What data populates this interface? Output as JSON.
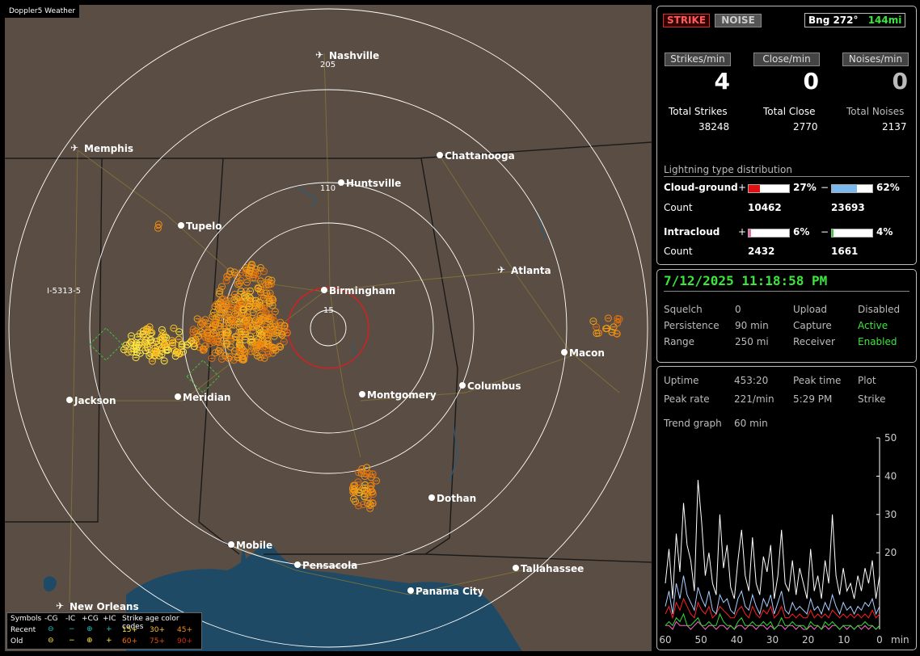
{
  "app": {
    "title": "Doppler5 Weather"
  },
  "map": {
    "cities": [
      {
        "name": "Nashville",
        "airport": true
      },
      {
        "name": "Memphis",
        "airport": true
      },
      {
        "name": "Chattanooga",
        "airport": false
      },
      {
        "name": "Huntsville",
        "airport": false
      },
      {
        "name": "Tupelo",
        "airport": false
      },
      {
        "name": "Birmingham",
        "airport": false
      },
      {
        "name": "Atlanta",
        "airport": true
      },
      {
        "name": "Macon",
        "airport": false
      },
      {
        "name": "Jackson",
        "airport": false
      },
      {
        "name": "Meridian",
        "airport": false
      },
      {
        "name": "Montgomery",
        "airport": false
      },
      {
        "name": "Columbus",
        "airport": false
      },
      {
        "name": "Dothan",
        "airport": false
      },
      {
        "name": "Mobile",
        "airport": false
      },
      {
        "name": "Pensacola",
        "airport": false
      },
      {
        "name": "Tallahassee",
        "airport": false
      },
      {
        "name": "Panama City",
        "airport": false
      },
      {
        "name": "New Orleans",
        "airport": true
      }
    ],
    "ring_labels": [
      "205",
      "110",
      "15"
    ],
    "road_label": "I-5313-5",
    "colors": {
      "land": "#5a4d44",
      "water": "#1e4a66",
      "ring": "#ffffff",
      "close_ring": "#d42020",
      "recent": "#ffe840",
      "older": "#f08a10"
    }
  },
  "legend": {
    "symbols_label": "Symbols",
    "cols": [
      "-CG",
      "-IC",
      "+CG",
      "+IC"
    ],
    "age_label": "Strike age color codes",
    "recent_label": "Recent",
    "old_label": "Old",
    "recent_ages": [
      "15+",
      "30+",
      "45+"
    ],
    "old_ages": [
      "60+",
      "75+",
      "90+"
    ]
  },
  "status": {
    "strike_btn": "STRIKE",
    "noise_btn": "NOISE",
    "bearing": "Bng 272°",
    "distance": "144mi",
    "rate_headers": [
      "Strikes/min",
      "Close/min",
      "Noises/min"
    ],
    "rate_values": [
      "4",
      "0",
      "0"
    ],
    "total_labels": [
      "Total Strikes",
      "Total Close",
      "Total Noises"
    ],
    "total_values": [
      "38248",
      "2770",
      "2137"
    ],
    "dist_title": "Lightning type distribution",
    "cg_label": "Cloud-ground",
    "cg_pos_pct": "27%",
    "cg_neg_pct": "62%",
    "cg_pos_frac": 0.27,
    "cg_neg_frac": 0.62,
    "count_label": "Count",
    "cg_pos_count": "10462",
    "cg_neg_count": "23693",
    "ic_label": "Intracloud",
    "ic_pos_pct": "6%",
    "ic_neg_pct": "4%",
    "ic_pos_frac": 0.06,
    "ic_neg_frac": 0.04,
    "ic_pos_count": "2432",
    "ic_neg_count": "1661",
    "plus": "+",
    "minus": "−"
  },
  "settings": {
    "datetime": "7/12/2025 11:18:58 PM",
    "rows": [
      {
        "k1": "Squelch",
        "v1": "0",
        "k2": "Upload",
        "v2": "Disabled"
      },
      {
        "k1": "Persistence",
        "v1": "90 min",
        "k2": "Capture",
        "v2": "Active"
      },
      {
        "k1": "Range",
        "v1": "250 mi",
        "k2": "Receiver",
        "v2": "Enabled"
      }
    ]
  },
  "stats": {
    "uptime_label": "Uptime",
    "uptime": "453:20",
    "peak_time_label": "Peak time",
    "plot_label": "Plot",
    "peak_rate_label": "Peak rate",
    "peak_rate": "221/min",
    "peak_time": "5:29 PM",
    "plot": "Strike",
    "trend_label": "Trend graph",
    "trend": "60 min"
  },
  "chart_data": {
    "type": "line",
    "title": "",
    "xlabel": "min",
    "ylabel": "",
    "x_ticks": [
      "60",
      "50",
      "40",
      "30",
      "20",
      "10",
      "0"
    ],
    "y_ticks": [
      "50",
      "40",
      "30",
      "20"
    ],
    "ylim": [
      0,
      50
    ],
    "xlim": [
      60,
      0
    ],
    "series": [
      {
        "color": "#ffffff",
        "values": [
          12,
          21,
          8,
          25,
          15,
          33,
          22,
          18,
          10,
          39,
          28,
          14,
          20,
          12,
          9,
          30,
          16,
          22,
          11,
          8,
          18,
          26,
          14,
          10,
          24,
          12,
          9,
          19,
          15,
          22,
          8,
          14,
          26,
          12,
          10,
          18,
          9,
          16,
          12,
          8,
          21,
          10,
          14,
          8,
          18,
          12,
          30,
          14,
          9,
          16,
          10,
          12,
          8,
          14,
          10,
          16,
          12,
          18,
          8,
          14
        ]
      },
      {
        "color": "#aaccff",
        "values": [
          6,
          10,
          4,
          12,
          8,
          14,
          9,
          7,
          5,
          11,
          8,
          6,
          10,
          5,
          4,
          9,
          7,
          8,
          5,
          4,
          8,
          10,
          6,
          5,
          9,
          6,
          4,
          8,
          6,
          9,
          4,
          7,
          10,
          5,
          4,
          7,
          5,
          6,
          5,
          4,
          8,
          5,
          6,
          4,
          7,
          5,
          9,
          6,
          4,
          7,
          5,
          6,
          4,
          6,
          5,
          7,
          6,
          8,
          4,
          6
        ]
      },
      {
        "color": "#ff2020",
        "values": [
          4,
          6,
          3,
          7,
          5,
          8,
          6,
          4,
          3,
          7,
          5,
          4,
          6,
          3,
          4,
          6,
          5,
          4,
          3,
          3,
          5,
          6,
          4,
          3,
          6,
          4,
          3,
          5,
          4,
          6,
          3,
          4,
          6,
          3,
          3,
          4,
          3,
          4,
          3,
          3,
          5,
          3,
          4,
          3,
          4,
          3,
          5,
          4,
          3,
          4,
          3,
          4,
          3,
          4,
          3,
          4,
          3,
          5,
          3,
          4
        ]
      },
      {
        "color": "#30e030",
        "values": [
          1,
          2,
          1,
          3,
          2,
          4,
          1,
          1,
          2,
          3,
          1,
          1,
          2,
          1,
          1,
          4,
          2,
          1,
          1,
          0,
          2,
          3,
          1,
          1,
          2,
          1,
          1,
          2,
          1,
          2,
          0,
          1,
          3,
          1,
          1,
          2,
          1,
          1,
          1,
          0,
          2,
          1,
          1,
          0,
          2,
          1,
          2,
          1,
          0,
          1,
          1,
          1,
          0,
          1,
          1,
          2,
          1,
          1,
          0,
          1
        ]
      },
      {
        "color": "#ff66cc",
        "values": [
          1,
          1,
          0,
          2,
          1,
          1,
          1,
          0,
          1,
          2,
          1,
          0,
          1,
          1,
          0,
          1,
          1,
          0,
          1,
          0,
          1,
          1,
          0,
          1,
          1,
          0,
          1,
          1,
          0,
          1,
          0,
          1,
          1,
          0,
          1,
          1,
          0,
          1,
          0,
          0,
          1,
          0,
          1,
          0,
          1,
          0,
          1,
          1,
          0,
          1,
          0,
          1,
          0,
          1,
          0,
          1,
          0,
          1,
          0,
          1
        ]
      }
    ]
  }
}
